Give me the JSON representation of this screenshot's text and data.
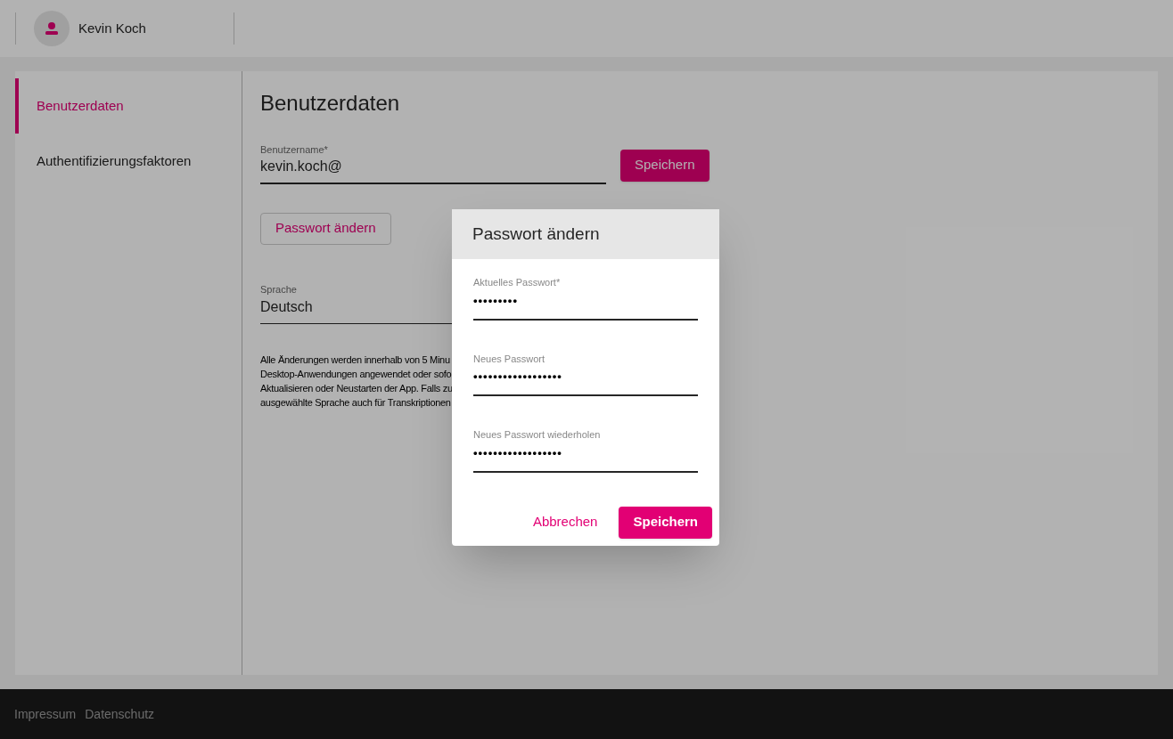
{
  "header": {
    "user_name": "Kevin Koch"
  },
  "sidebar": {
    "items": [
      {
        "label": "Benutzerdaten",
        "selected": true
      },
      {
        "label": "Authentifizierungsfaktoren",
        "selected": false
      }
    ]
  },
  "content": {
    "title": "Benutzerdaten",
    "username": {
      "label": "Benutzername*",
      "value": "kevin.koch@"
    },
    "save_button": "Speichern",
    "change_password_button": "Passwort ändern",
    "language": {
      "label": "Sprache",
      "value": "Deutsch"
    },
    "note_lines": [
      "Alle Änderungen werden innerhalb von 5 Minu",
      "Desktop-Anwendungen angewendet oder sofo",
      "Aktualisieren oder Neustarten der App. Falls zu",
      "ausgewählte Sprache auch für Transkriptionen"
    ]
  },
  "dialog": {
    "title": "Passwort ändern",
    "fields": [
      {
        "label": "Aktuelles Passwort*",
        "value": "•••••••••"
      },
      {
        "label": "Neues Passwort",
        "value": "••••••••••••••••••"
      },
      {
        "label": "Neues Passwort wiederholen",
        "value": "••••••••••••••••••"
      }
    ],
    "cancel": "Abbrechen",
    "save": "Speichern"
  },
  "footer": {
    "links": [
      "Impressum",
      "Datenschutz"
    ]
  }
}
